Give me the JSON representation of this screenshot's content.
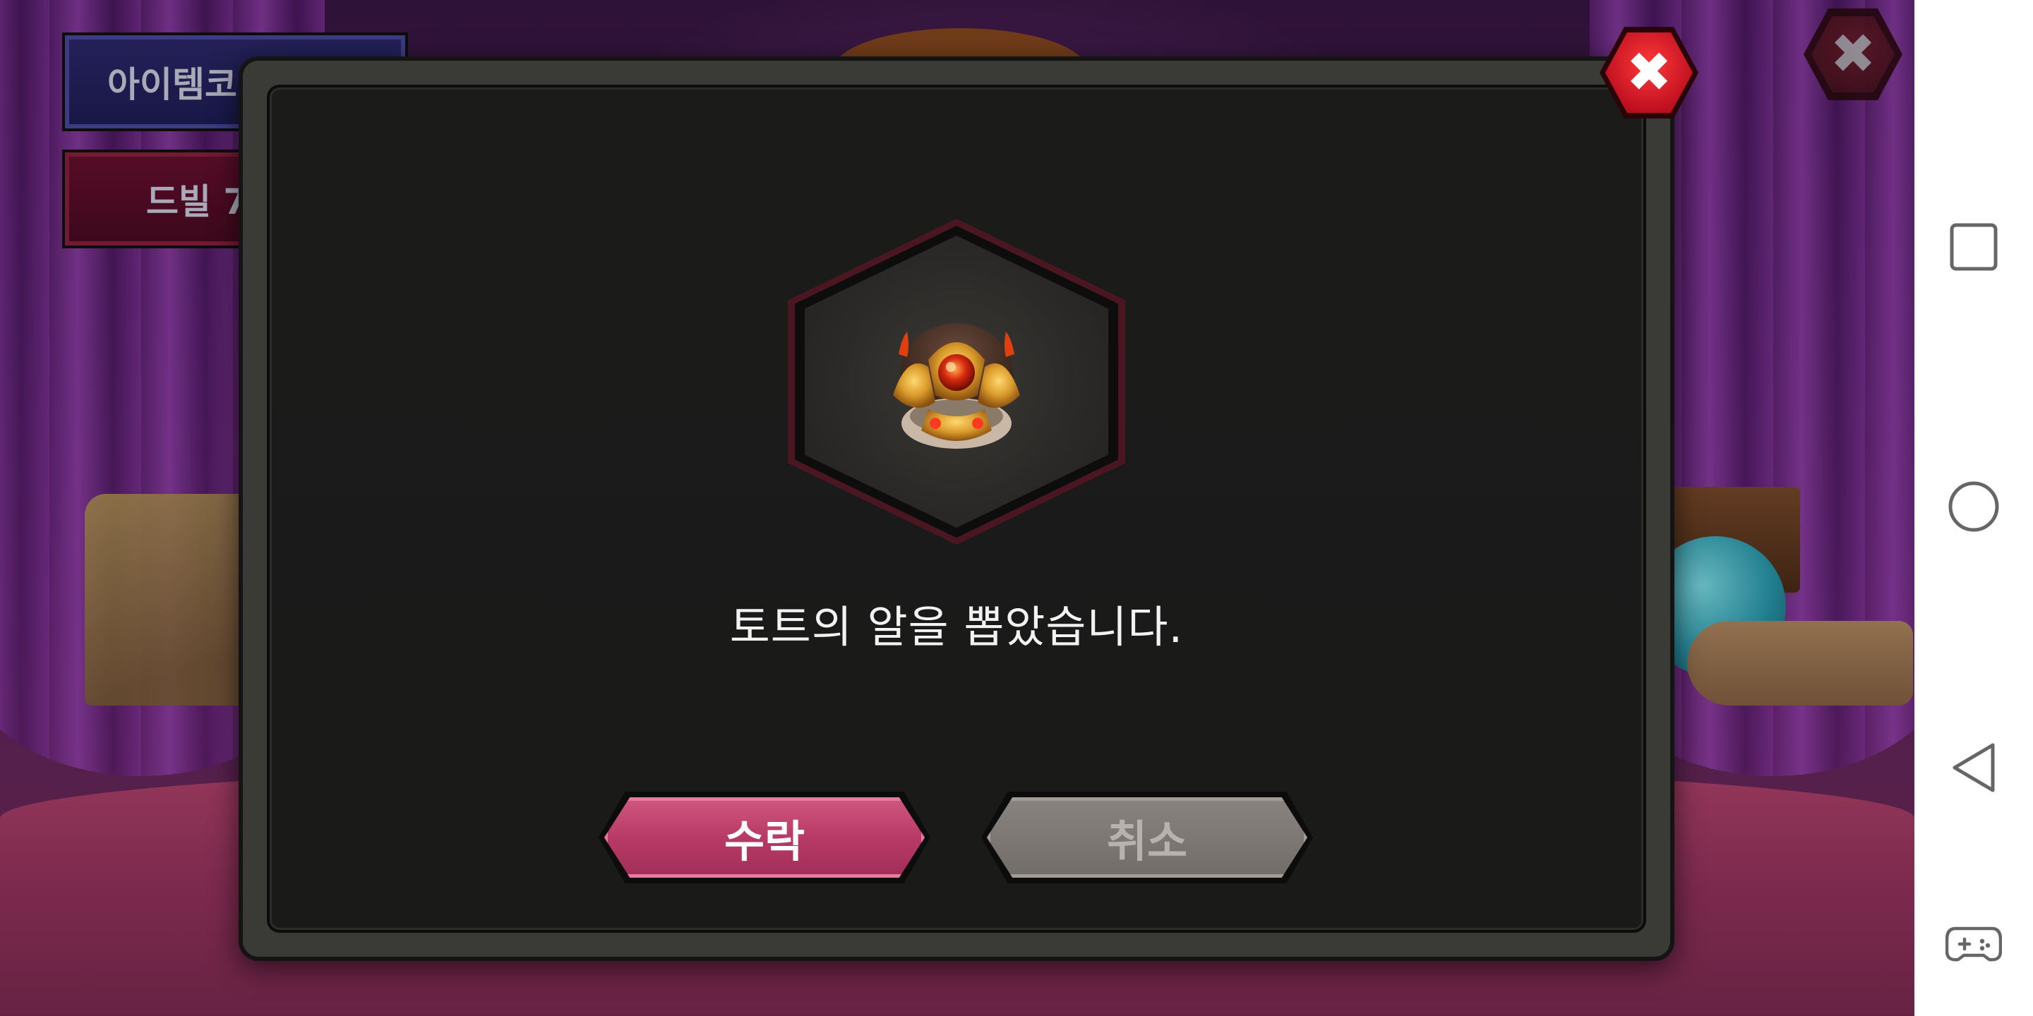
{
  "side_menu": {
    "item_code_label": "아이템코",
    "devil_label": "드빌 7"
  },
  "dialog": {
    "message": "토트의 알을 뽑았습니다.",
    "accept_label": "수락",
    "cancel_label": "취소",
    "close_glyph": "✖"
  },
  "game": {
    "outer_close_glyph": "✖"
  },
  "colors": {
    "accent_pink": "#b83a66",
    "cancel_gray": "#7a746f",
    "close_red": "#d0142a",
    "dialog_bg": "#1b1b1a"
  },
  "icons": {
    "reward": "thoth-egg-icon",
    "nav": [
      "recents-square-icon",
      "home-circle-icon",
      "back-triangle-icon",
      "gamepad-icon"
    ]
  }
}
